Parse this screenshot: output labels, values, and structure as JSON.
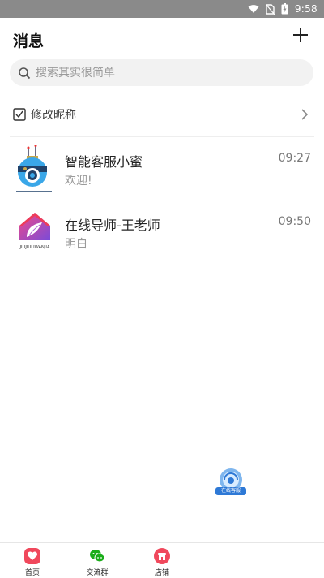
{
  "status_bar": {
    "time": "9:58"
  },
  "header": {
    "title": "消息",
    "add_icon": "plus-icon"
  },
  "search": {
    "placeholder": "搜索其实很简单"
  },
  "nickname_row": {
    "label": "修改昵称"
  },
  "conversations": [
    {
      "name": "智能客服小蜜",
      "message": "欢迎!",
      "time": "09:27"
    },
    {
      "name": "在线导师-王老师",
      "message": "明白",
      "time": "09:50"
    }
  ],
  "avatar_brand": {
    "text": "JIUJIULIWANJIA"
  },
  "support_float": {
    "label": "在线客服"
  },
  "bottom_nav": [
    {
      "label": "首页",
      "icon": "heart-icon",
      "color": "#f0485c"
    },
    {
      "label": "交流群",
      "icon": "wechat-icon",
      "color": "#1aad19"
    },
    {
      "label": "店铺",
      "icon": "shop-icon",
      "color": "#f0485c"
    }
  ]
}
